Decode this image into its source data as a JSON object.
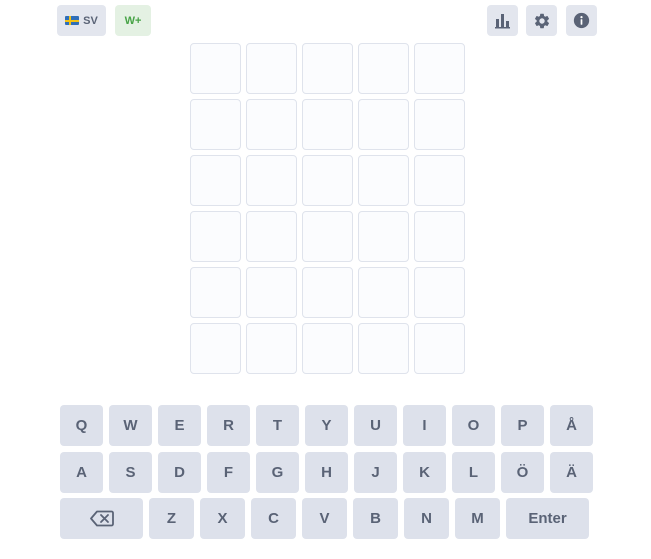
{
  "header": {
    "language_label": "SV",
    "wplus_label": "W+",
    "icons": {
      "stats": "bar-chart-icon",
      "settings": "gear-icon",
      "info": "info-icon",
      "flag": "swedish-flag-icon"
    }
  },
  "board": {
    "rows": [
      [
        "",
        "",
        "",
        "",
        ""
      ],
      [
        "",
        "",
        "",
        "",
        ""
      ],
      [
        "",
        "",
        "",
        "",
        ""
      ],
      [
        "",
        "",
        "",
        "",
        ""
      ],
      [
        "",
        "",
        "",
        "",
        ""
      ],
      [
        "",
        "",
        "",
        "",
        ""
      ]
    ]
  },
  "keyboard": {
    "row1": [
      "Q",
      "W",
      "E",
      "R",
      "T",
      "Y",
      "U",
      "I",
      "O",
      "P",
      "Å"
    ],
    "row2": [
      "A",
      "S",
      "D",
      "F",
      "G",
      "H",
      "J",
      "K",
      "L",
      "Ö",
      "Ä"
    ],
    "row3": [
      "Z",
      "X",
      "C",
      "V",
      "B",
      "N",
      "M"
    ],
    "backspace_icon": "backspace-icon",
    "enter_label": "Enter"
  },
  "colors": {
    "key_background": "#dde1eb",
    "key_text": "#5a6376",
    "tile_border": "#dfe3ec",
    "wplus_text": "#47a346",
    "wplus_background": "#e4f1e3"
  }
}
